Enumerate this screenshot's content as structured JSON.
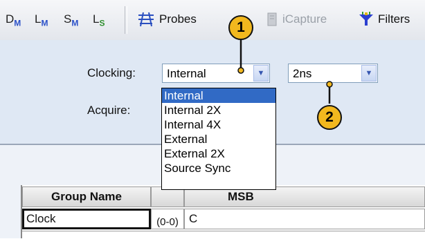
{
  "toolbar": {
    "signals": [
      {
        "main": "D",
        "sub": "M"
      },
      {
        "main": "L",
        "sub": "M"
      },
      {
        "main": "S",
        "sub": "M"
      },
      {
        "main": "L",
        "sub": "S"
      }
    ],
    "probes_label": "Probes",
    "icapture_label": "iCapture",
    "filters_label": "Filters"
  },
  "settings": {
    "clocking_label": "Clocking:",
    "acquire_label": "Acquire:",
    "clocking_value": "Internal",
    "rate_value": "2ns"
  },
  "dropdown": {
    "options": [
      "Internal",
      "Internal 2X",
      "Internal 4X",
      "External",
      "External 2X",
      "Source Sync"
    ],
    "selected_index": 0
  },
  "table": {
    "headers": {
      "group_name": "Group Name",
      "msb": "MSB"
    },
    "rows": [
      {
        "group_name": "Clock",
        "range": "(0-0)",
        "msb": "C"
      }
    ]
  },
  "callouts": [
    "1",
    "2"
  ],
  "colors": {
    "panel_bg": "#dfe8f4",
    "selection": "#316ac5",
    "callout_fill": "#f2b81e"
  }
}
